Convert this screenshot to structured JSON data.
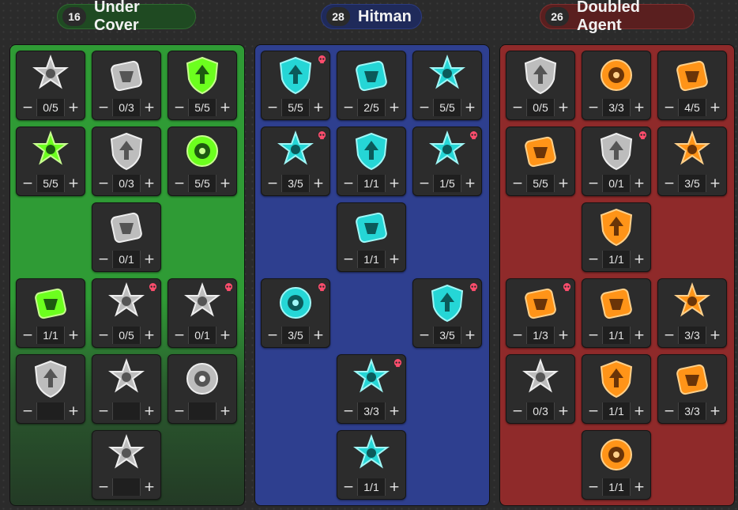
{
  "trees": [
    {
      "name": "Under Cover",
      "points": "16",
      "color": "#2f8f2f",
      "header_bg": "#1f4a22",
      "icon_color": "#cfcfcf",
      "accent": "#7dff2a",
      "perks": [
        {
          "icon": "shield-arrow-icon",
          "value": "0/5",
          "style": "silver",
          "skull": false
        },
        {
          "icon": "dna-icon",
          "value": "0/3",
          "style": "silver",
          "skull": false
        },
        {
          "icon": "hourglass-shield-icon",
          "value": "5/5",
          "style": "green",
          "skull": false
        },
        {
          "icon": "skull-burst-icon",
          "value": "5/5",
          "style": "green",
          "skull": false
        },
        {
          "icon": "medical-shield-icon",
          "value": "0/3",
          "style": "silver",
          "skull": false
        },
        {
          "icon": "medkit-burst-icon",
          "value": "5/5",
          "style": "green",
          "skull": false
        },
        {
          "icon": "body-armor-icon",
          "value": "0/1",
          "style": "silver",
          "skull": false
        },
        {
          "icon": "clock-burst-icon",
          "value": "1/1",
          "style": "green",
          "skull": false
        },
        {
          "icon": "frozen-heart-icon",
          "value": "0/5",
          "style": "silver",
          "skull": true
        },
        {
          "icon": "grenade-icon",
          "value": "0/1",
          "style": "silver",
          "skull": true
        },
        {
          "icon": "frozen-armor-icon",
          "value": "",
          "style": "silver",
          "skull": false
        },
        {
          "icon": "frozen-shield-icon",
          "value": "",
          "style": "silver",
          "skull": false
        },
        {
          "icon": "crosshair-icon",
          "value": "",
          "style": "silver",
          "skull": false
        },
        {
          "icon": "armored-soldier-icon",
          "value": "",
          "style": "silver",
          "skull": false
        }
      ]
    },
    {
      "name": "Hitman",
      "points": "28",
      "color": "#2e3f8f",
      "header_bg": "#1f2a5a",
      "icon_color": "#2ee6e6",
      "accent": "#2ee6e6",
      "perks": [
        {
          "icon": "bullets-icon",
          "value": "5/5",
          "style": "cyan",
          "skull": true
        },
        {
          "icon": "magazine-shield-icon",
          "value": "2/5",
          "style": "cyan",
          "skull": false
        },
        {
          "icon": "rabbit-icon",
          "value": "5/5",
          "style": "cyan",
          "skull": false
        },
        {
          "icon": "phone-burst-icon",
          "value": "3/5",
          "style": "cyan",
          "skull": true
        },
        {
          "icon": "grenade-spark-icon",
          "value": "1/1",
          "style": "cyan",
          "skull": false
        },
        {
          "icon": "jaws-icon",
          "value": "1/5",
          "style": "cyan",
          "skull": true
        },
        {
          "icon": "skull-box-icon",
          "value": "1/1",
          "style": "cyan",
          "skull": false
        },
        {
          "icon": "bullet-burst-icon",
          "value": "3/5",
          "style": "cyan",
          "skull": true
        },
        {
          "icon": "bullet-split-icon",
          "value": "3/5",
          "style": "cyan",
          "skull": true
        },
        {
          "icon": "hourglass-spray-icon",
          "value": "3/3",
          "style": "cyan",
          "skull": true
        },
        {
          "icon": "reaper-icon",
          "value": "1/1",
          "style": "cyan",
          "skull": false
        }
      ]
    },
    {
      "name": "Doubled Agent",
      "points": "26",
      "color": "#8f2a2a",
      "header_bg": "#5a1f1f",
      "icon_color": "#ff9a1f",
      "accent": "#ff9a1f",
      "perks": [
        {
          "icon": "hand-card-icon",
          "value": "0/5",
          "style": "silver",
          "skull": false
        },
        {
          "icon": "magazines-icon",
          "value": "3/3",
          "style": "orange",
          "skull": false
        },
        {
          "icon": "stopwatch-icon",
          "value": "4/5",
          "style": "orange",
          "skull": false
        },
        {
          "icon": "flexing-hands-icon",
          "value": "5/5",
          "style": "orange",
          "skull": false
        },
        {
          "icon": "brain-icon",
          "value": "0/1",
          "style": "silver",
          "skull": true
        },
        {
          "icon": "bandage-icon",
          "value": "3/5",
          "style": "orange",
          "skull": false
        },
        {
          "icon": "shield-burst-icon",
          "value": "1/1",
          "style": "orange",
          "skull": false
        },
        {
          "icon": "basket-icon",
          "value": "1/3",
          "style": "orange",
          "skull": true
        },
        {
          "icon": "skull-crossbones-icon",
          "value": "1/1",
          "style": "orange",
          "skull": false
        },
        {
          "icon": "running-rabbit-icon",
          "value": "3/3",
          "style": "orange",
          "skull": false
        },
        {
          "icon": "hand-sound-icon",
          "value": "0/3",
          "style": "silver",
          "skull": false
        },
        {
          "icon": "muscle-torso-icon",
          "value": "1/1",
          "style": "orange",
          "skull": false
        },
        {
          "icon": "explosive-hands-icon",
          "value": "3/3",
          "style": "orange",
          "skull": false
        },
        {
          "icon": "pistol-spark-icon",
          "value": "1/1",
          "style": "orange",
          "skull": false
        }
      ]
    }
  ],
  "controls": {
    "minus": "−",
    "plus": "+"
  }
}
